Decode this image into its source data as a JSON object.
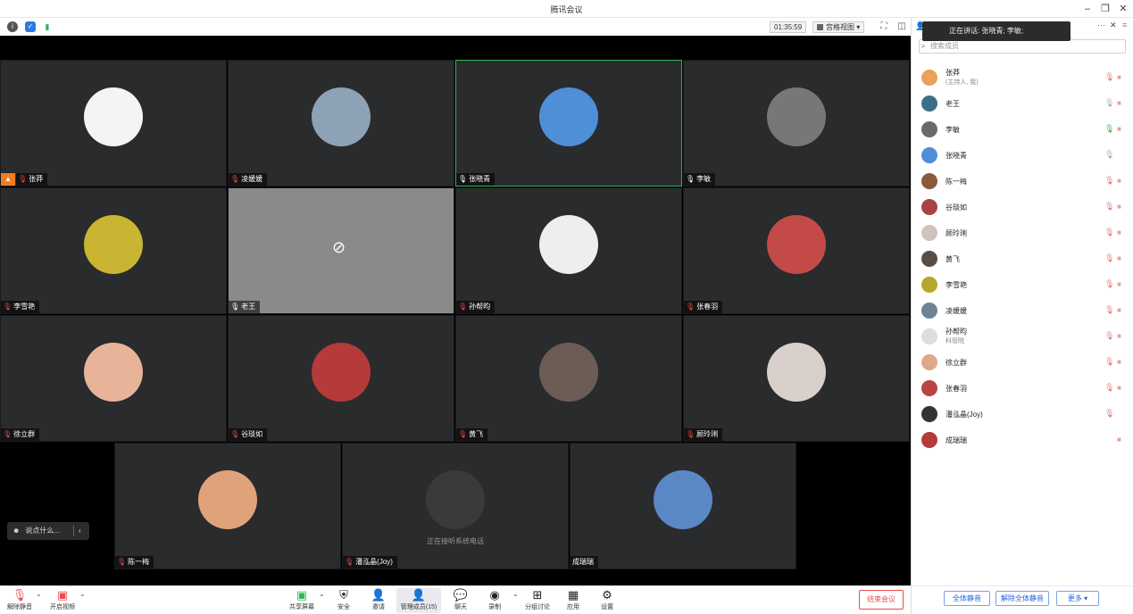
{
  "window": {
    "title": "腾讯会议"
  },
  "toolbar": {
    "timer": "01:35:59",
    "view_label": "宫格视图"
  },
  "speaking": {
    "label": "正在讲话: 张晓青; 李敏;"
  },
  "tiles": [
    {
      "name": "张莽",
      "muted": true,
      "host": true,
      "active": false,
      "avatar_color": "#f4f4f4"
    },
    {
      "name": "凌媛媛",
      "muted": true,
      "active": false,
      "avatar_color": "#8ea2b5"
    },
    {
      "name": "张晓青",
      "muted": false,
      "active": true,
      "avatar_color": "#4f8fd8"
    },
    {
      "name": "李敏",
      "muted": false,
      "active": false,
      "avatar_color": "#777777"
    },
    {
      "name": "李雪艳",
      "muted": true,
      "active": false,
      "avatar_color": "#c9b531"
    },
    {
      "name": "老王",
      "muted": false,
      "active": false,
      "camera_off": true
    },
    {
      "name": "孙帮昀",
      "muted": true,
      "active": false,
      "avatar_color": "#eeeeee"
    },
    {
      "name": "张春羽",
      "muted": true,
      "active": false,
      "avatar_color": "#c34a47"
    },
    {
      "name": "徐立群",
      "muted": true,
      "active": false,
      "avatar_color": "#e7b49a"
    },
    {
      "name": "谷琰如",
      "muted": true,
      "active": false,
      "avatar_color": "#b53a3a"
    },
    {
      "name": "黄飞",
      "muted": true,
      "active": false,
      "avatar_color": "#6b5d55"
    },
    {
      "name": "顾玲琍",
      "muted": true,
      "active": false,
      "avatar_color": "#d9d0cc"
    },
    {
      "name": "陈一梅",
      "muted": true,
      "active": false,
      "avatar_color": "#e0a27a"
    },
    {
      "name": "潘泓晶(Joy)",
      "muted": true,
      "active": false,
      "avatar_color": "#3a3a3a",
      "caption": "正在接听系统电话"
    },
    {
      "name": "成瑞瑞",
      "muted": false,
      "no_mic": true,
      "active": false,
      "avatar_color": "#5a88c7"
    }
  ],
  "chat_pill": {
    "label": "说点什么..."
  },
  "bottom": {
    "mute": "解除静音",
    "video": "开启视频",
    "share": "共享屏幕",
    "security": "安全",
    "invite": "邀请",
    "members": "管理成员(15)",
    "chat": "聊天",
    "record": "录制",
    "breakout": "分组讨论",
    "apps": "应用",
    "settings": "设置",
    "end": "结束会议"
  },
  "panel": {
    "search_placeholder": "搜索成员",
    "members": [
      {
        "name": "张莽",
        "sub": "(主持人, 我)",
        "mic": "muted",
        "color": "#e9a25a"
      },
      {
        "name": "老王",
        "mic": "grey",
        "color": "#3c6e8a"
      },
      {
        "name": "李敏",
        "mic": "on",
        "color": "#6a6a6a"
      },
      {
        "name": "张晓青",
        "mic": "grey",
        "color": "#4f8fd8",
        "no_cam": true
      },
      {
        "name": "陈一梅",
        "mic": "muted",
        "color": "#8a5a3a"
      },
      {
        "name": "谷琰如",
        "mic": "muted",
        "color": "#a8433f"
      },
      {
        "name": "顾玲琍",
        "mic": "muted",
        "color": "#cfc3bc"
      },
      {
        "name": "黄飞",
        "mic": "muted",
        "color": "#5a4d46"
      },
      {
        "name": "李雪艳",
        "mic": "muted",
        "color": "#b9a62a"
      },
      {
        "name": "凌媛媛",
        "mic": "muted",
        "color": "#6f8396"
      },
      {
        "name": "孙帮昀",
        "sub": "科管院",
        "mic": "muted",
        "color": "#dddddd"
      },
      {
        "name": "徐立群",
        "mic": "muted",
        "color": "#e0a88a"
      },
      {
        "name": "张春羽",
        "mic": "muted",
        "color": "#b84543"
      },
      {
        "name": "潘泓晶(Joy)",
        "mic": "muted",
        "color": "#333333",
        "no_cam": true
      },
      {
        "name": "成瑞瑞",
        "mic": "none",
        "color": "#b53a3a"
      }
    ],
    "mute_all": "全体静音",
    "unmute_all": "解除全体静音",
    "more": "更多"
  }
}
